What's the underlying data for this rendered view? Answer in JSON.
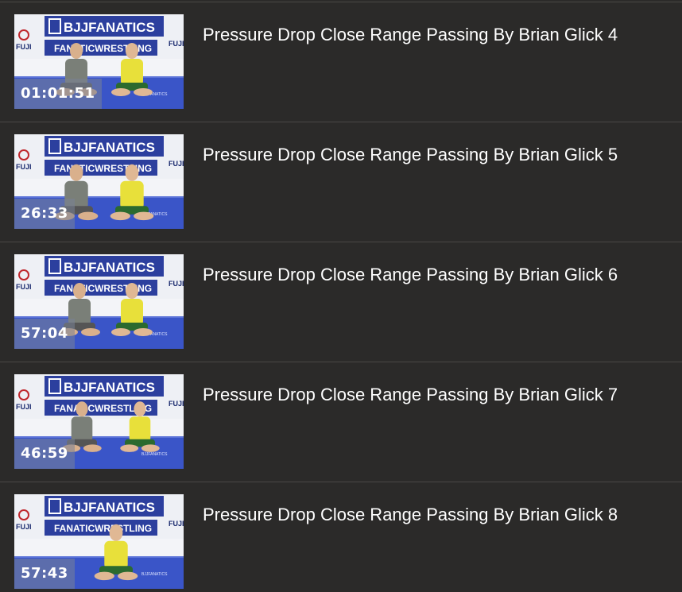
{
  "videos": [
    {
      "title": "Pressure Drop Close Range Passing By Brian Glick 4",
      "duration": "01:01:51",
      "banner_text": "BJJFANATICS",
      "sub_banner_text": "FANATICWRESTLING",
      "logo_text": "FUJI"
    },
    {
      "title": "Pressure Drop Close Range Passing By Brian Glick 5",
      "duration": "26:33",
      "banner_text": "BJJFANATICS",
      "sub_banner_text": "FANATICWRESTLING",
      "logo_text": "FUJI"
    },
    {
      "title": "Pressure Drop Close Range Passing By Brian Glick 6",
      "duration": "57:04",
      "banner_text": "BJJFANATICS",
      "sub_banner_text": "FANATICWRESTLING",
      "logo_text": "FUJI"
    },
    {
      "title": "Pressure Drop Close Range Passing By Brian Glick 7",
      "duration": "46:59",
      "banner_text": "BJJFANATICS",
      "sub_banner_text": "FANATICWRESTLING",
      "logo_text": "FUJI"
    },
    {
      "title": "Pressure Drop Close Range Passing By Brian Glick 8",
      "duration": "57:43",
      "banner_text": "BJJFANATICS",
      "sub_banner_text": "FANATICWRESTLING",
      "logo_text": "FUJI"
    }
  ],
  "colors": {
    "background": "#2b2a29",
    "divider": "#4a4846",
    "title_text": "#ffffff",
    "banner_blue": "#2c3f9e",
    "mat_blue": "#3a55c8",
    "jersey_yellow": "#e8e03a",
    "shirt_grey": "#7a7f78"
  }
}
